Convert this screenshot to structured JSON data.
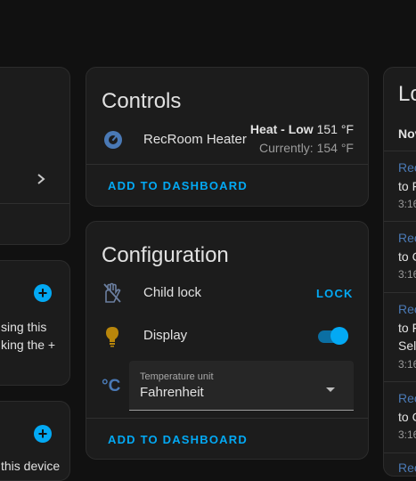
{
  "left_card_text": {
    "line1": "sing this",
    "line2": "king the +",
    "line3": "this device"
  },
  "controls": {
    "title": "Controls",
    "entity_name": "RecRoom Heater",
    "mode": "Heat - Low",
    "target_temp": "151 °F",
    "current": "Currently: 154 °F",
    "add_button": "ADD TO DASHBOARD"
  },
  "configuration": {
    "title": "Configuration",
    "child_lock_label": "Child lock",
    "lock_button": "LOCK",
    "display_label": "Display",
    "display_on": true,
    "unit_icon": "°C",
    "unit_field_label": "Temperature unit",
    "unit_value": "Fahrenheit",
    "add_button": "ADD TO DASHBOARD"
  },
  "logbook": {
    "title": "Lo",
    "date_header": "Nov",
    "entries": [
      {
        "name": "Rec",
        "action": "to F",
        "time": "3:16"
      },
      {
        "name": "Rec",
        "action": "to C",
        "time": "3:16"
      },
      {
        "name": "Rec",
        "action": "to F",
        "extra": "Sele",
        "time": "3:16"
      },
      {
        "name": "Rec",
        "action": "to C",
        "time": "3:16"
      },
      {
        "name": "Rec"
      }
    ]
  },
  "colors": {
    "accent": "#03a9f4",
    "icon": "#4a79b5",
    "bulb": "#b8860b"
  }
}
